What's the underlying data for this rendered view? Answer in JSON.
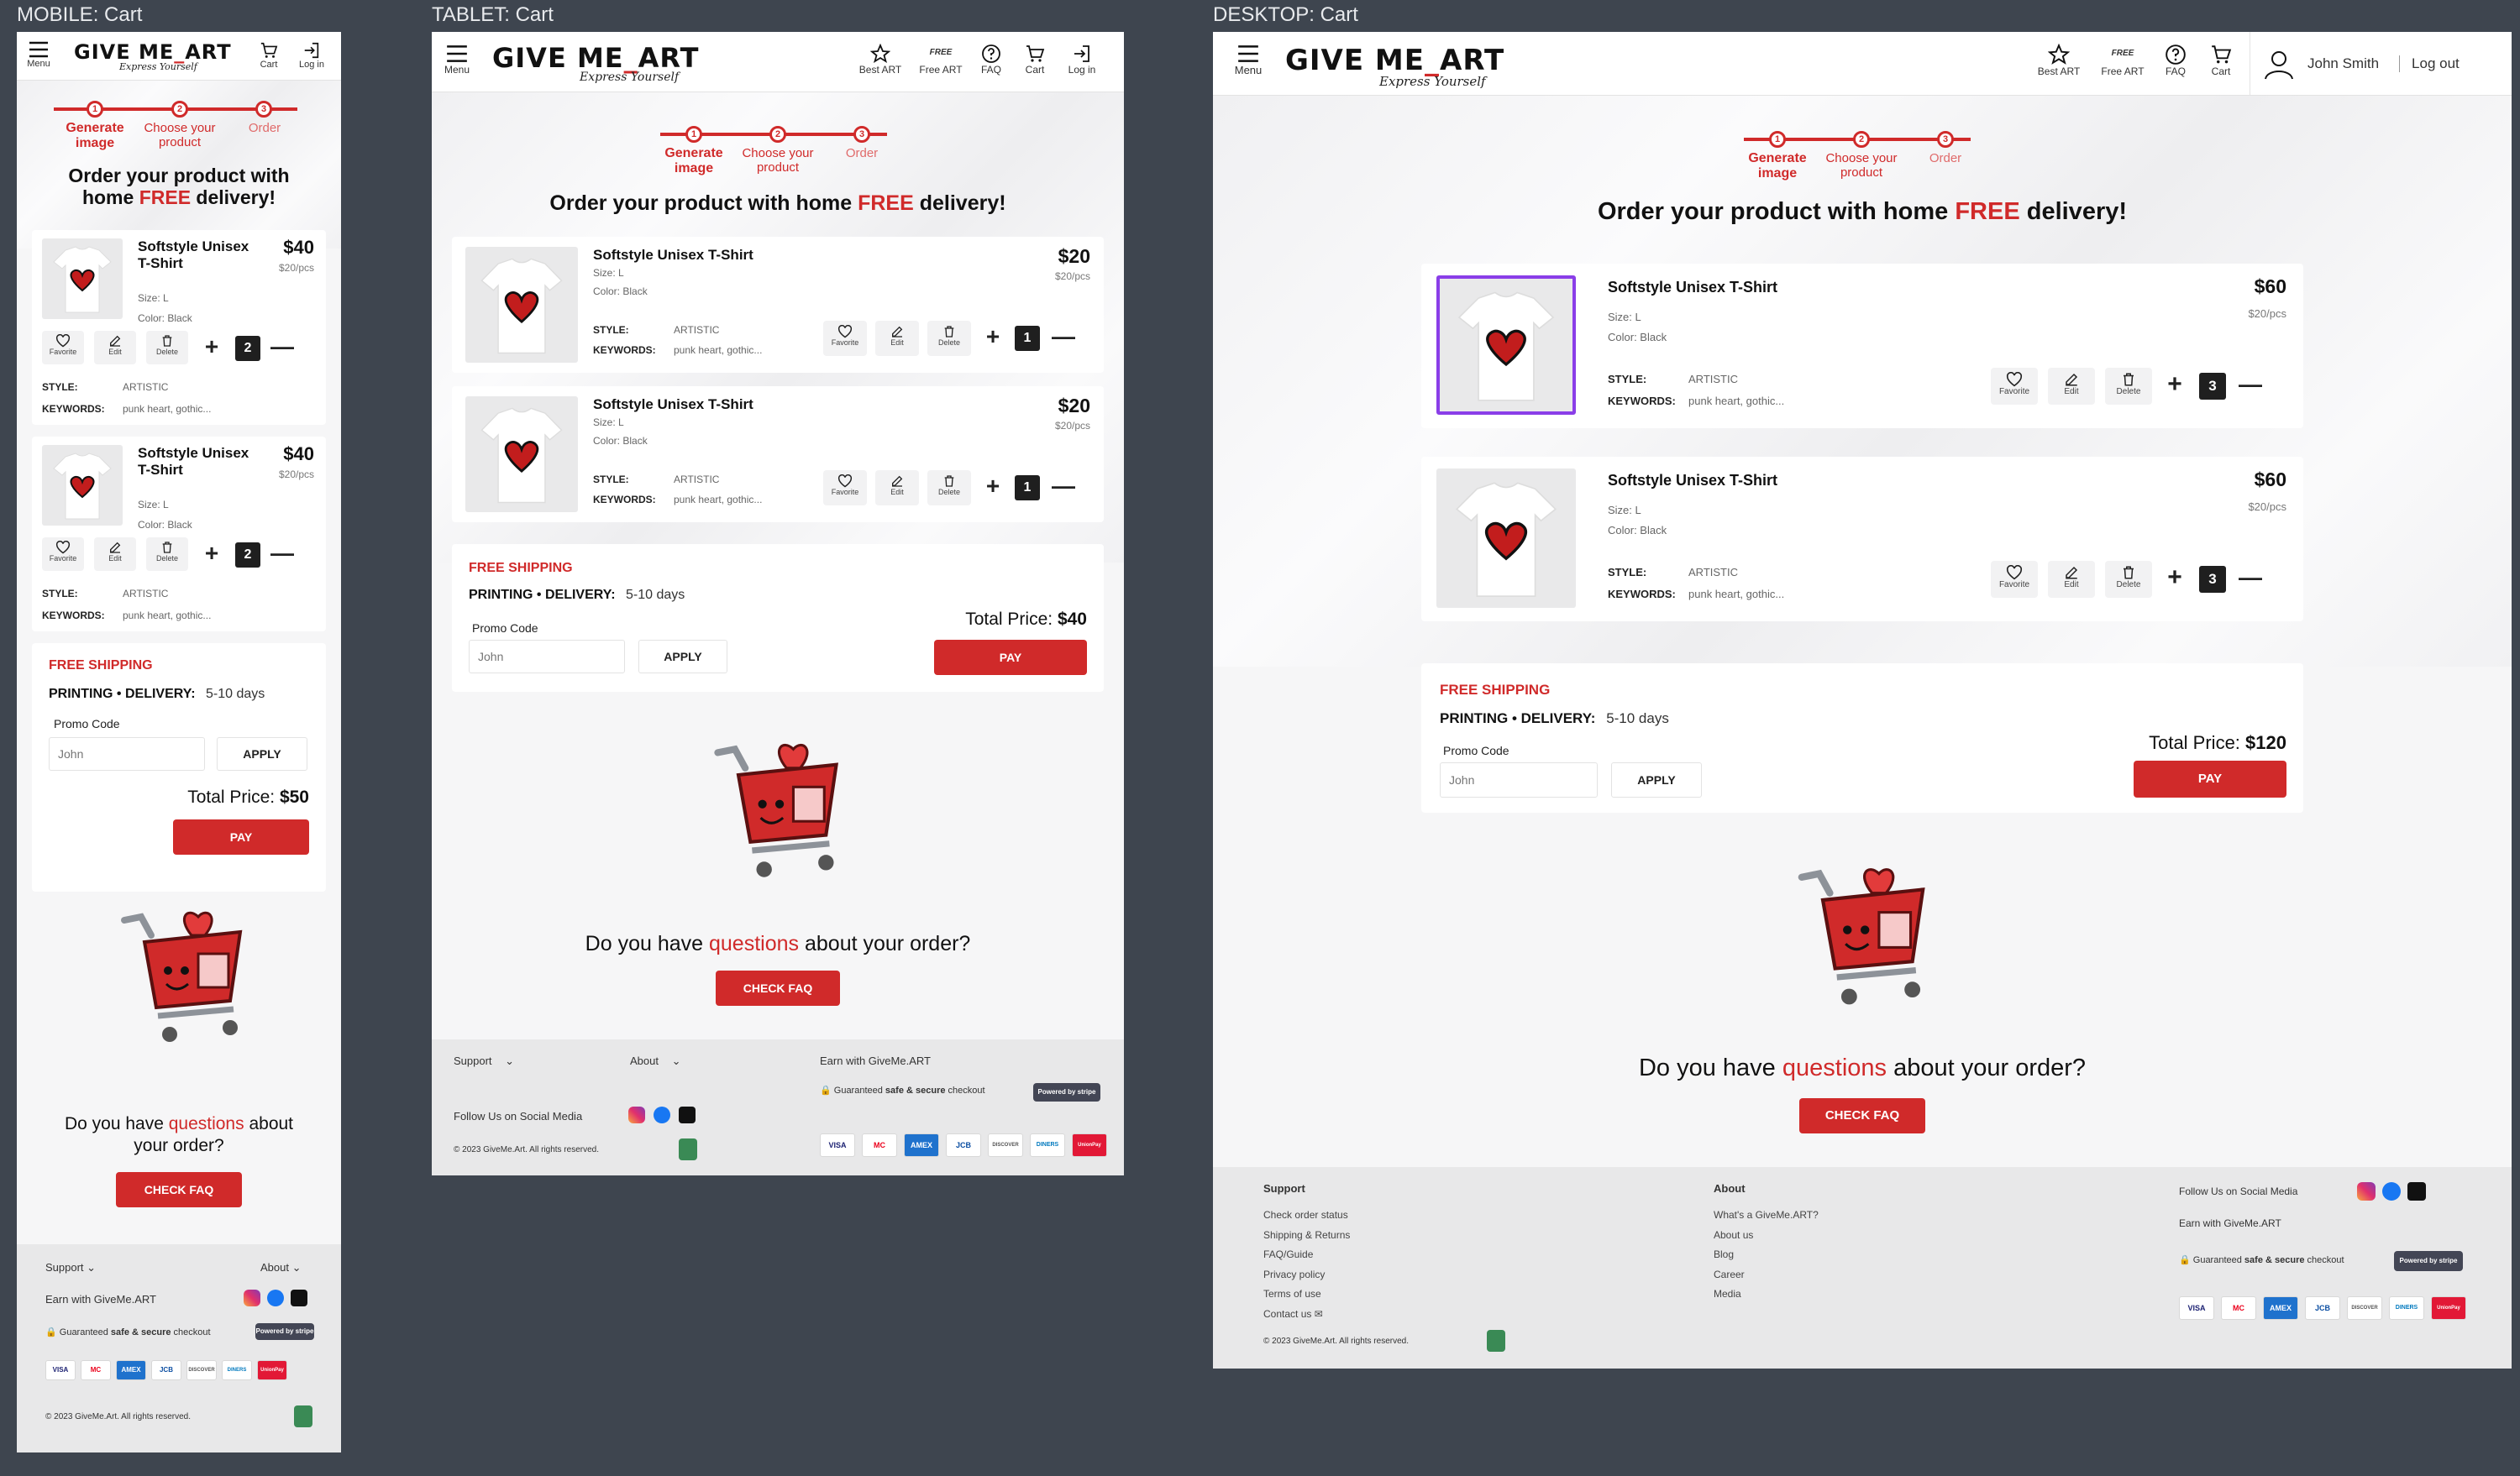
{
  "frames": {
    "mobile_label": "MOBILE:  Cart",
    "tablet_label": "TABLET: Cart",
    "desktop_label": "DESKTOP: Cart"
  },
  "brand": {
    "logo_left": "GIVE ME",
    "logo_dash": "_",
    "logo_right": "ART",
    "tagline": "Express Yourself",
    "accent": "#d02a2a",
    "selection": "#8a3ee8"
  },
  "header": {
    "menu": "Menu",
    "best_art": "Best ART",
    "free_badge": "FREE",
    "free_art": "Free ART",
    "faq": "FAQ",
    "cart": "Cart",
    "login": "Log in",
    "user_name": "John Smith",
    "logout": "Log out"
  },
  "steps": {
    "s1_num": "1",
    "s1_label": "Generate image",
    "s2_num": "2",
    "s2_label": "Choose your product",
    "s3_num": "3",
    "s3_label": "Order"
  },
  "heading": {
    "before": "Order your product with home ",
    "free": "FREE",
    "after": " delivery!"
  },
  "product": {
    "title": "Softstyle Unisex T-Shirt",
    "size": "Size: L",
    "color": "Color: Black",
    "style_key": "STYLE:",
    "style_val": "ARTISTIC",
    "keywords_key": "KEYWORDS:",
    "keywords_val": "punk heart, gothic...",
    "favorite": "Favorite",
    "edit": "Edit",
    "delete": "Delete"
  },
  "mobile": {
    "price": "$40",
    "unit": "$20/pcs",
    "qty": "2",
    "total": "$50"
  },
  "tablet": {
    "price": "$20",
    "unit": "$20/pcs",
    "qty": "1",
    "total": "$40"
  },
  "desktop": {
    "price": "$60",
    "unit": "$20/pcs",
    "qty": "3",
    "total": "$120"
  },
  "shipping": {
    "free_shipping": "FREE SHIPPING",
    "printing": "PRINTING",
    "dot": "•",
    "delivery": "DELIVERY:",
    "days": "5-10 days",
    "promo_label": "Promo Code",
    "promo_placeholder": "John",
    "apply": "APPLY",
    "total_label": "Total Price:",
    "pay": "PAY"
  },
  "question": {
    "before": "Do you have ",
    "q": "questions",
    "after": " about your order?",
    "after_mobile_1": " about",
    "after_mobile_2": "your order?",
    "button": "CHECK FAQ"
  },
  "footer": {
    "support": "Support",
    "about": "About",
    "earn": "Earn with GiveMe.ART",
    "follow": "Follow Us on Social Media",
    "secure_1": "Guaranteed ",
    "secure_b": "safe & secure",
    "secure_2": " checkout",
    "stripe": "Powered by stripe",
    "copyright": "© 2023 GiveMe.Art. All rights reserved.",
    "support_links": [
      "Check order status",
      "Shipping & Returns",
      "FAQ/Guide",
      "Privacy policy",
      "Terms of use",
      "Contact us"
    ],
    "about_links": [
      "What's a GiveMe.ART?",
      "About us",
      "Blog",
      "Career",
      "Media"
    ],
    "payments": [
      "VISA",
      "MC",
      "AMEX",
      "JCB",
      "DISCOVER",
      "DINERS",
      "UnionPay"
    ]
  }
}
